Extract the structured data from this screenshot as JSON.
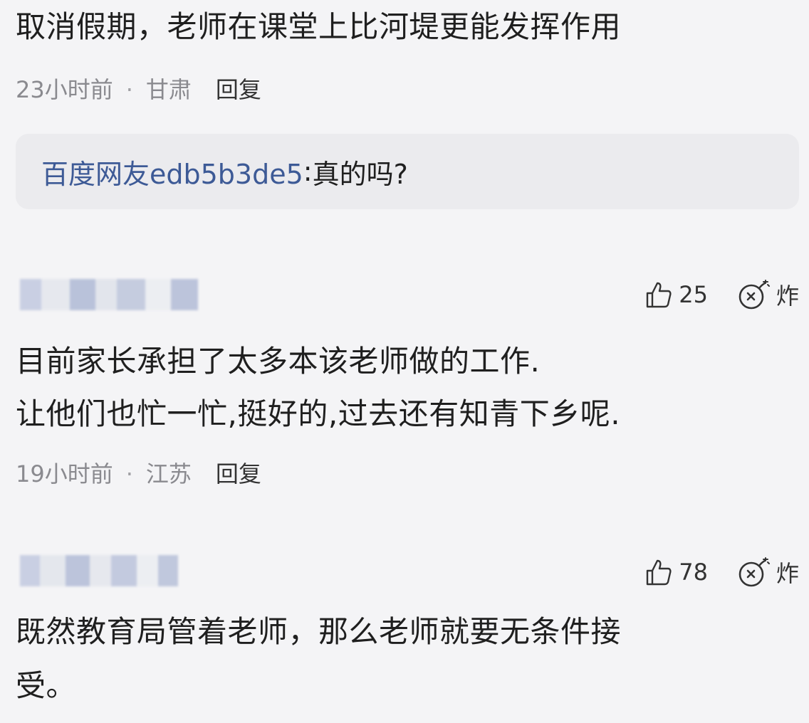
{
  "comment1": {
    "text": "取消假期，老师在课堂上比河堤更能发挥作用",
    "time": "23小时前",
    "separator": "·",
    "location": "甘肃",
    "reply_label": "回复",
    "reply_thread": {
      "user": "百度网友edb5b3de5",
      "colon": ": ",
      "text": "真的吗?"
    }
  },
  "comment2": {
    "username_blurred": true,
    "likes": "25",
    "boom_label": "炸",
    "line1": "目前家长承担了太多本该老师做的工作.",
    "line2": "让他们也忙一忙,挺好的,过去还有知青下乡呢.",
    "time": "19小时前",
    "separator": "·",
    "location": "江苏",
    "reply_label": "回复"
  },
  "comment3": {
    "username_blurred": true,
    "likes": "78",
    "boom_label": "炸",
    "line1": "既然教育局管着老师，那么老师就要无条件接",
    "line2": "受。"
  },
  "icons": {
    "like": "thumbs-up-icon",
    "boom": "bomb-icon"
  },
  "colors": {
    "background": "#f4f4f6",
    "reply_box": "#ebebee",
    "username_link": "#3d5a96",
    "meta_text": "#8a8a8f"
  }
}
